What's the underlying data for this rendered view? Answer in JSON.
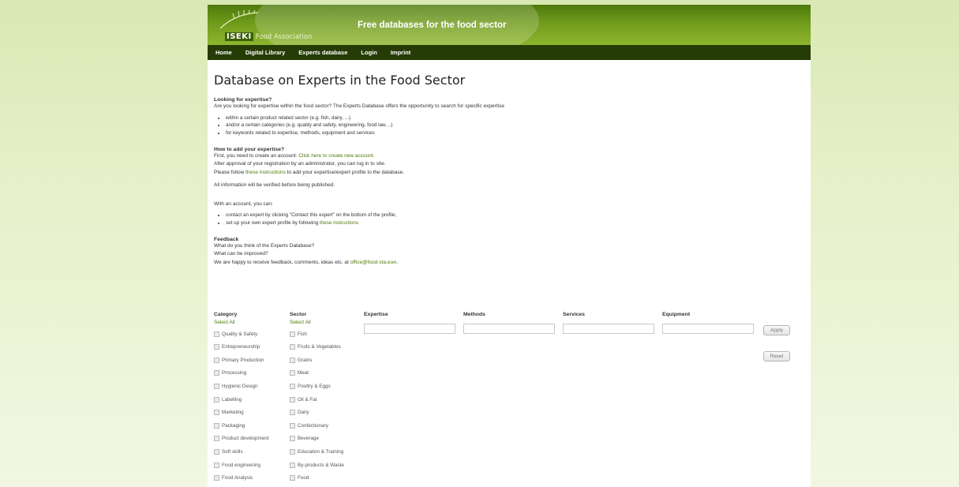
{
  "header": {
    "logo_main": "ISEKI",
    "logo_sub": "Food Association",
    "site_title": "Free databases for the food sector"
  },
  "nav": [
    "Home",
    "Digital Library",
    "Experts database",
    "Login",
    "Imprint"
  ],
  "page_title": "Database on Experts in the Food Sector",
  "looking": {
    "heading": "Looking for expertise?",
    "intro": "Are you looking for expertise within the food sector? The Experts Database offers the opportunity to search for specific expertise",
    "items": [
      "within a certain product related sector (e.g. fish, dairy, ...)",
      "and/or a certain categories (e.g. quality and safety, engineering, food law, ..)",
      "for keywords related to expertise, methods, equipment and services"
    ]
  },
  "add": {
    "heading": "How to add your expertise?",
    "line1_pre": "First, you need to create an account: ",
    "line1_link": "Click here to create new account.",
    "line2": "After approval of your registration by an administrator, you can log in to site.",
    "line3_pre": "Please follow ",
    "line3_link": "these instructions",
    "line3_post": " to add your expertise/expert profile to the database.",
    "verified": "All information will be verified before being published."
  },
  "account": {
    "intro": "With an account, you can:",
    "item1": "contact an expert by clicking \"Contact this expert\" on the bottom of the profile;",
    "item2_pre": "set up your own expert profile by following ",
    "item2_link": "these instructions"
  },
  "feedback": {
    "heading": "Feedback",
    "line1": "What do you think of the Experts Database?",
    "line2": "What can be improved?",
    "line3_pre": "We are happy to receive feedback, comments, ideas etc. at ",
    "email": "office@food-sta.eu",
    "line3_post": "."
  },
  "filters": {
    "category_label": "Category",
    "sector_label": "Sector",
    "select_all": "Select All",
    "expertise_label": "Expertise",
    "methods_label": "Methods",
    "services_label": "Services",
    "equipment_label": "Equipment",
    "apply": "Apply",
    "reset": "Reset",
    "categories": [
      "Quality & Safety",
      "Entrepreneurship",
      "Primary Production",
      "Processing",
      "Hygienic Design",
      "Labelling",
      "Marketing",
      "Packaging",
      "Product development",
      "Soft skills",
      "Food engineering",
      "Food Analysis"
    ],
    "sectors": [
      "Fish",
      "Fruits & Vegetables",
      "Grains",
      "Meat",
      "Poultry & Eggs",
      "Oil & Fat",
      "Dairy",
      "Confectionary",
      "Beverage",
      "Education & Training",
      "By-products & Waste",
      "Food"
    ]
  }
}
